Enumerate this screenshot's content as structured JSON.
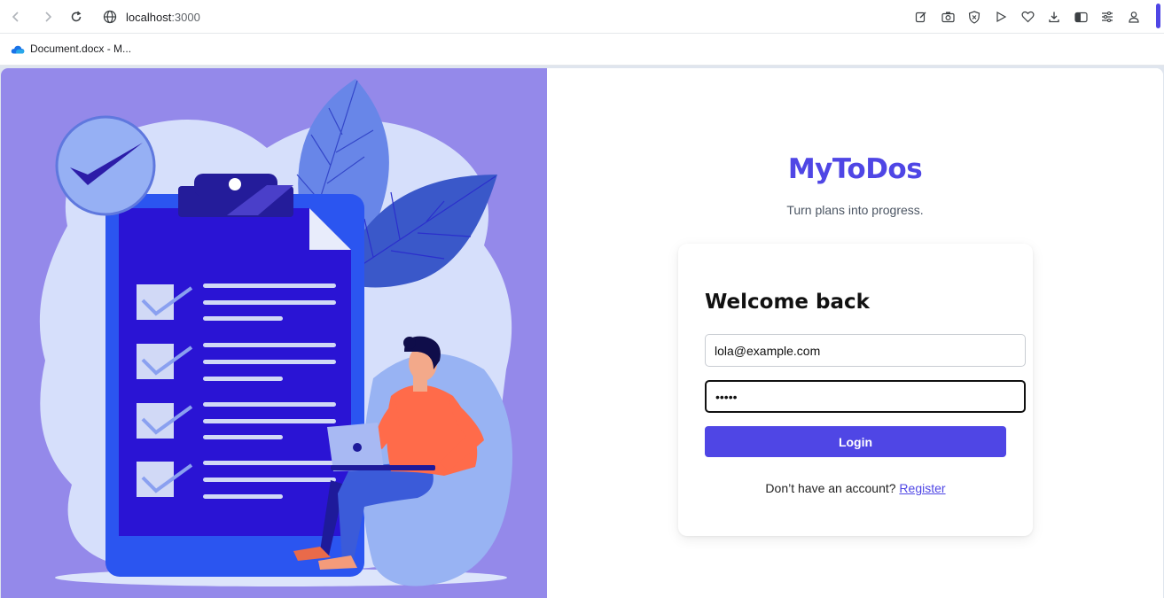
{
  "browser": {
    "url_host": "localhost",
    "url_port": ":3000",
    "accent_color": "#4f46e5"
  },
  "bookmarks": [
    {
      "label": "Document.docx - M...",
      "icon": "onedrive-cloud-icon"
    }
  ],
  "app": {
    "brand": "MyToDos",
    "tagline": "Turn plans into progress.",
    "brand_color": "#4f46e5",
    "hero_bg_color": "#9489ea"
  },
  "login": {
    "heading": "Welcome back",
    "email_value": "lola@example.com",
    "password_value": "•••••",
    "submit_label": "Login",
    "register_prompt": "Don’t have an account? ",
    "register_link": "Register"
  }
}
